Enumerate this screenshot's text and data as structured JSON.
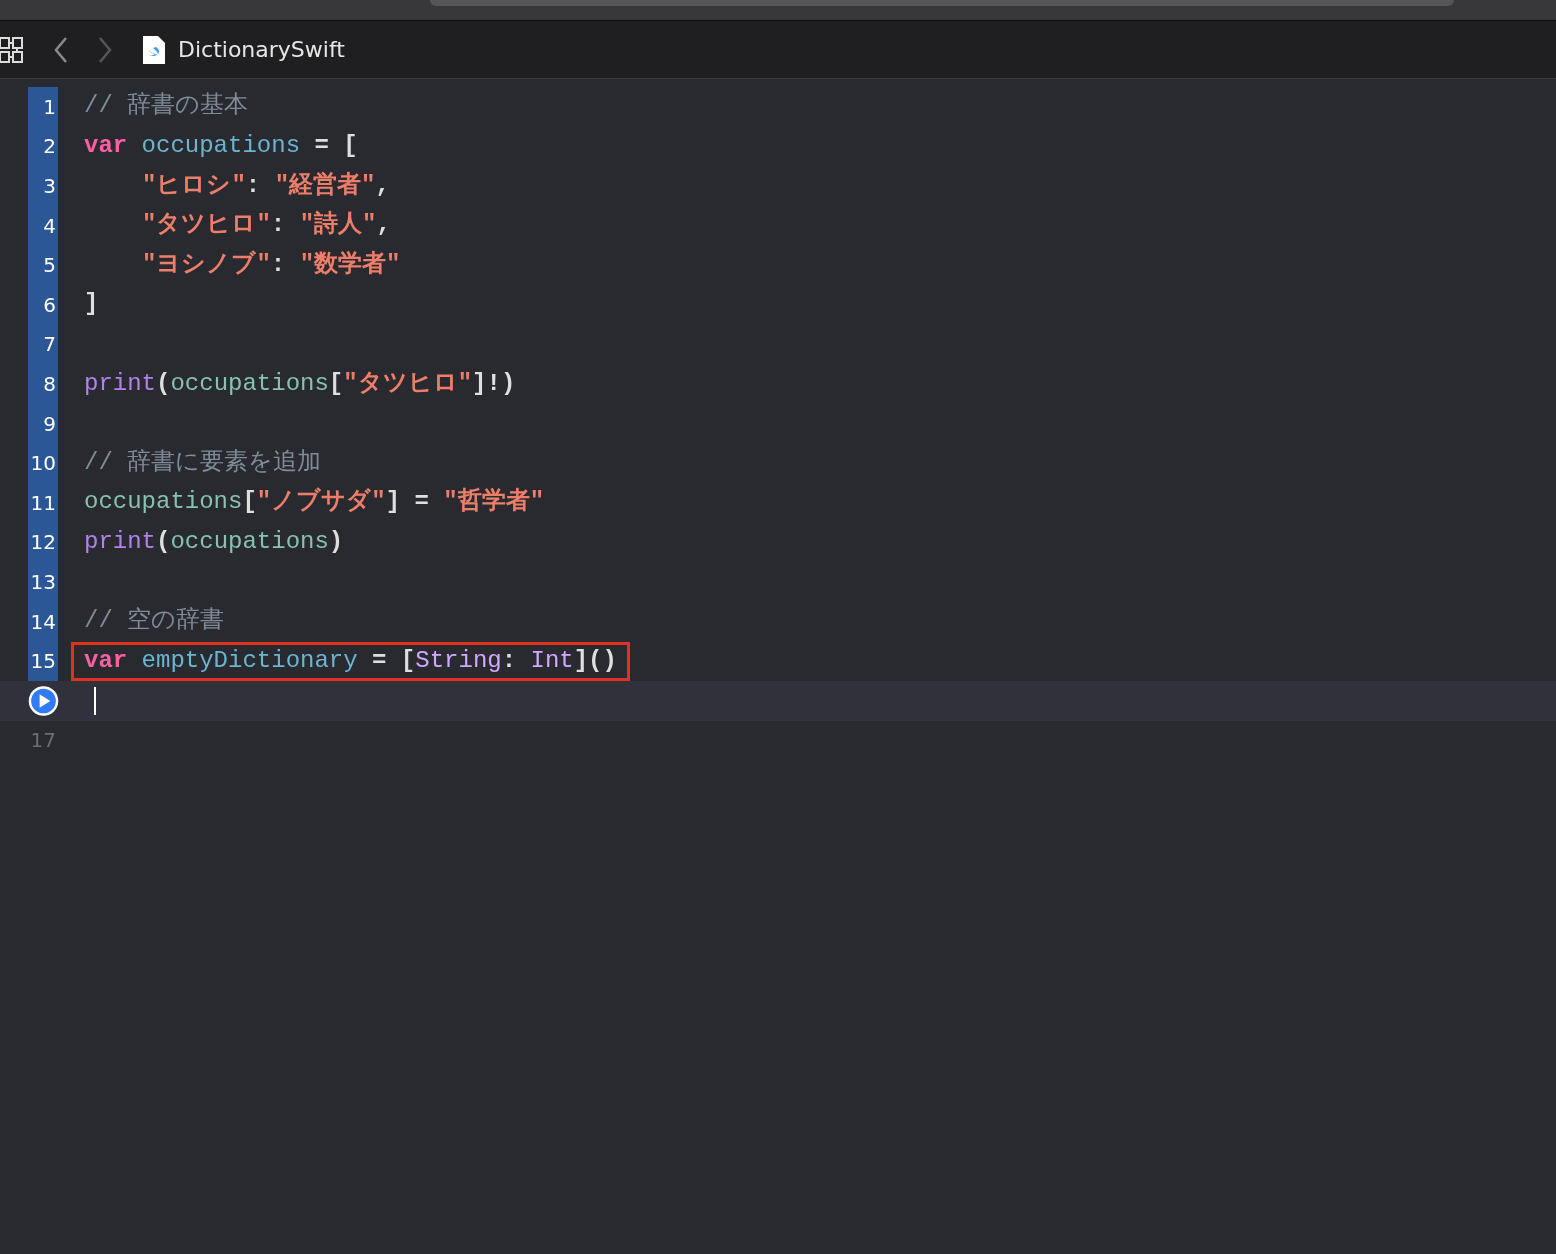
{
  "toolbar": {
    "title": "DictionarySwift",
    "back_enabled": true,
    "forward_enabled": false
  },
  "editor": {
    "lines": [
      {
        "number": "1",
        "executed": true,
        "tokens": [
          {
            "kind": "comment",
            "text": "// 辞書の基本"
          }
        ]
      },
      {
        "number": "2",
        "executed": true,
        "tokens": [
          {
            "kind": "keyword",
            "text": "var "
          },
          {
            "kind": "decl",
            "text": "occupations"
          },
          {
            "kind": "plain",
            "text": " = ["
          }
        ]
      },
      {
        "number": "3",
        "executed": true,
        "indented": true,
        "tokens": [
          {
            "kind": "string",
            "text": "\"ヒロシ\""
          },
          {
            "kind": "plain",
            "text": ": "
          },
          {
            "kind": "string",
            "text": "\"経営者\""
          },
          {
            "kind": "plain",
            "text": ","
          }
        ]
      },
      {
        "number": "4",
        "executed": true,
        "indented": true,
        "tokens": [
          {
            "kind": "string",
            "text": "\"タツヒロ\""
          },
          {
            "kind": "plain",
            "text": ": "
          },
          {
            "kind": "string",
            "text": "\"詩人\""
          },
          {
            "kind": "plain",
            "text": ","
          }
        ]
      },
      {
        "number": "5",
        "executed": true,
        "indented": true,
        "tokens": [
          {
            "kind": "string",
            "text": "\"ヨシノブ\""
          },
          {
            "kind": "plain",
            "text": ": "
          },
          {
            "kind": "string",
            "text": "\"数学者\""
          }
        ]
      },
      {
        "number": "6",
        "executed": true,
        "tokens": [
          {
            "kind": "plain",
            "text": "]"
          }
        ]
      },
      {
        "number": "7",
        "executed": true
      },
      {
        "number": "8",
        "executed": true,
        "tokens": [
          {
            "kind": "func",
            "text": "print"
          },
          {
            "kind": "plain",
            "text": "("
          },
          {
            "kind": "ref",
            "text": "occupations"
          },
          {
            "kind": "plain",
            "text": "["
          },
          {
            "kind": "string",
            "text": "\"タツヒロ\""
          },
          {
            "kind": "plain",
            "text": "]!)"
          }
        ]
      },
      {
        "number": "9",
        "executed": true
      },
      {
        "number": "10",
        "executed": true,
        "tokens": [
          {
            "kind": "comment",
            "text": "// 辞書に要素を追加"
          }
        ]
      },
      {
        "number": "11",
        "executed": true,
        "tokens": [
          {
            "kind": "ref",
            "text": "occupations"
          },
          {
            "kind": "plain",
            "text": "["
          },
          {
            "kind": "string",
            "text": "\"ノブサダ\""
          },
          {
            "kind": "plain",
            "text": "] = "
          },
          {
            "kind": "string",
            "text": "\"哲学者\""
          }
        ]
      },
      {
        "number": "12",
        "executed": true,
        "tokens": [
          {
            "kind": "func",
            "text": "print"
          },
          {
            "kind": "plain",
            "text": "("
          },
          {
            "kind": "ref",
            "text": "occupations"
          },
          {
            "kind": "plain",
            "text": ")"
          }
        ]
      },
      {
        "number": "13",
        "executed": true
      },
      {
        "number": "14",
        "executed": true,
        "tokens": [
          {
            "kind": "comment",
            "text": "// 空の辞書"
          }
        ]
      },
      {
        "number": "15",
        "executed": true,
        "boxed": true,
        "tokens": [
          {
            "kind": "keyword",
            "text": "var "
          },
          {
            "kind": "decl",
            "text": "emptyDictionary"
          },
          {
            "kind": "plain",
            "text": " = ["
          },
          {
            "kind": "type",
            "text": "String"
          },
          {
            "kind": "plain",
            "text": ": "
          },
          {
            "kind": "type",
            "text": "Int"
          },
          {
            "kind": "plain",
            "text": "]()"
          }
        ]
      },
      {
        "executed": false,
        "current": true
      },
      {
        "number": "17",
        "executed": false
      }
    ]
  }
}
